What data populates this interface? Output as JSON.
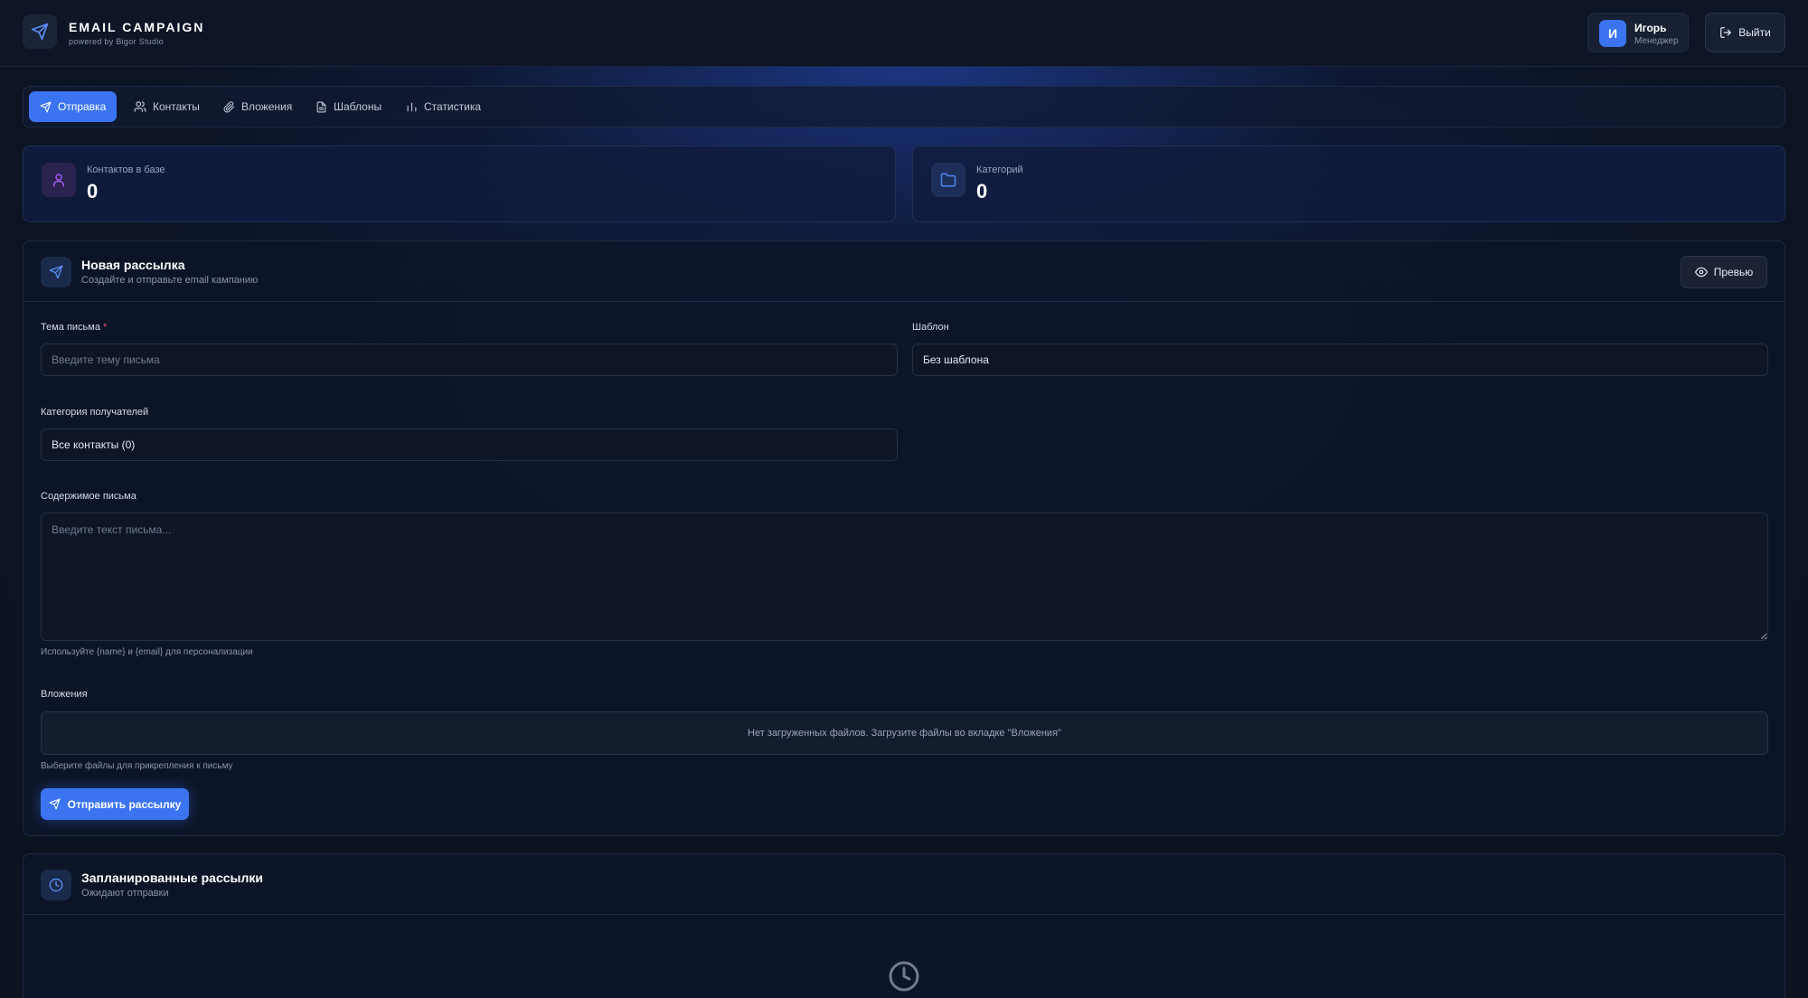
{
  "header": {
    "title": "EMAIL CAMPAIGN",
    "subtitle": "powered by Bigor Studio",
    "user_initial": "И",
    "user_name": "Игорь",
    "user_role": "Менеджер",
    "logout_label": "Выйти"
  },
  "tabs": [
    {
      "label": "Отправка",
      "icon": "send-icon",
      "active": true
    },
    {
      "label": "Контакты",
      "icon": "users-icon",
      "active": false
    },
    {
      "label": "Вложения",
      "icon": "paperclip-icon",
      "active": false
    },
    {
      "label": "Шаблоны",
      "icon": "file-icon",
      "active": false
    },
    {
      "label": "Статистика",
      "icon": "bar-chart-icon",
      "active": false
    }
  ],
  "stats": [
    {
      "label": "Контактов в базе",
      "value": "0",
      "icon": "user-icon"
    },
    {
      "label": "Категорий",
      "value": "0",
      "icon": "folder-icon"
    }
  ],
  "campaign": {
    "title": "Новая рассылка",
    "subtitle": "Создайте и отправьте email кампанию",
    "preview_label": "Превью",
    "subject_label": "Тема письма",
    "subject_required": "*",
    "subject_placeholder": "Введите тему письма",
    "template_label": "Шаблон",
    "template_value": "Без шаблона",
    "category_label": "Категория получателей",
    "category_value": "Все контакты (0)",
    "content_label": "Содержимое письма",
    "content_placeholder": "Введите текст письма...",
    "content_hint": "Используйте {name} и {email} для персонализации",
    "attachments_label": "Вложения",
    "attachments_empty": "Нет загруженных файлов. Загрузите файлы во вкладке \"Вложения\"",
    "attachments_hint": "Выберите файлы для прикрепления к письму",
    "send_label": "Отправить рассылку"
  },
  "scheduled": {
    "title": "Запланированные рассылки",
    "subtitle": "Ожидают отправки"
  },
  "colors": {
    "accent": "#3b74f0",
    "background": "#0b1220",
    "stat_user_icon": "#a45cf0",
    "stat_folder_icon": "#4f86f7"
  }
}
